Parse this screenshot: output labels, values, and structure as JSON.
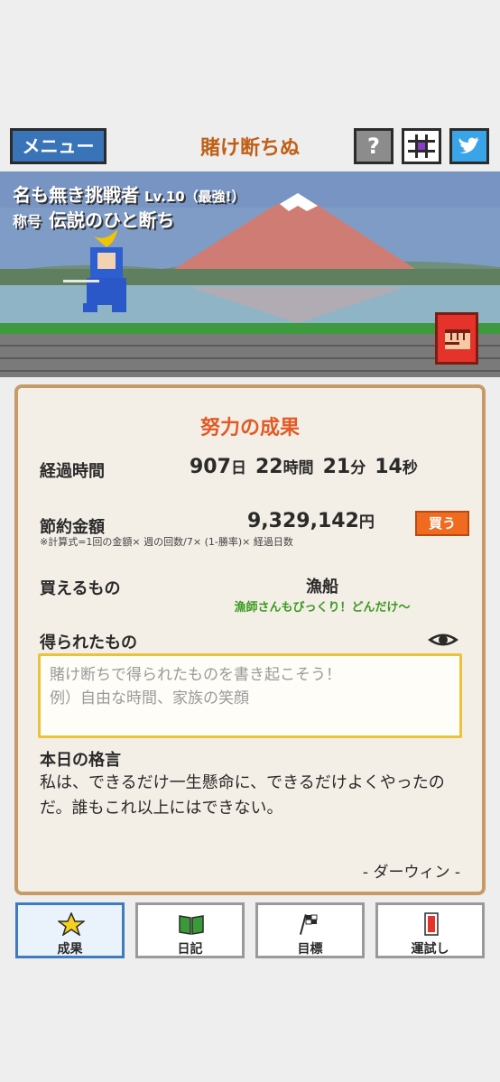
{
  "header": {
    "menu_label": "メニュー",
    "app_title": "賭け断ちぬ",
    "help_label": "?"
  },
  "player": {
    "name": "名も無き挑戦者",
    "level": "Lv.10（最強!）",
    "title_label": "称号",
    "title": "伝説のひと断ち"
  },
  "panel": {
    "title": "努力の成果",
    "elapsed": {
      "label": "経過時間",
      "days": "907",
      "days_unit": "日",
      "hours": "22",
      "hours_unit": "時間",
      "minutes": "21",
      "minutes_unit": "分",
      "seconds": "14",
      "seconds_unit": "秒"
    },
    "saved": {
      "label": "節約金額",
      "amount": "9,329,142",
      "unit": "円",
      "buy_label": "買う",
      "formula": "※計算式=1回の金額× 週の回数/7× (1-勝率)× 経過日数"
    },
    "buyable": {
      "label": "買えるもの",
      "item": "漁船",
      "comment": "漁師さんもびっくり！どんだけ〜"
    },
    "gained": {
      "label": "得られたもの",
      "placeholder_line1": "賭け断ちで得られたものを書き起こそう！",
      "placeholder_line2": "例）自由な時間、家族の笑顔"
    },
    "quote": {
      "label": "本日の格言",
      "text": "私は、できるだけ一生懸命に、できるだけよくやったのだ。誰もこれ以上にはできない。",
      "author": "- ダーウィン -"
    }
  },
  "tabs": [
    {
      "label": "成果",
      "icon": "star-icon",
      "active": true
    },
    {
      "label": "日記",
      "icon": "book-icon",
      "active": false
    },
    {
      "label": "目標",
      "icon": "flag-icon",
      "active": false
    },
    {
      "label": "運試し",
      "icon": "card-icon",
      "active": false
    }
  ],
  "colors": {
    "accent_orange": "#e25a26",
    "menu_blue": "#3a74b8",
    "panel_border": "#c79a67",
    "comment_green": "#3a9a20"
  }
}
